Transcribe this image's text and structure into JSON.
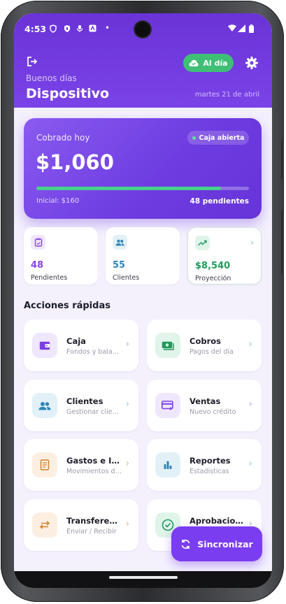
{
  "status": {
    "time": "4:53"
  },
  "header": {
    "greeting": "Buenos días",
    "title": "Dispositivo",
    "date": "martes 21 de abril",
    "sync_status": "Al día"
  },
  "summary": {
    "label": "Cobrado hoy",
    "amount": "$1,060",
    "badge": "Caja abierta",
    "progress_fraction": 0.87,
    "initial": "Inicial: $160",
    "pending": "48 pendientes"
  },
  "stats": [
    {
      "value": "48",
      "label": "Pendientes",
      "icon": "clipboard-icon",
      "color": "#8a44e8"
    },
    {
      "value": "55",
      "label": "Clientes",
      "icon": "people-icon",
      "color": "#2f86b8"
    },
    {
      "value": "$8,540",
      "label": "Proyección",
      "icon": "trend-up-icon",
      "color": "#1f9a5a"
    }
  ],
  "quick_actions_title": "Acciones rápidas",
  "actions": [
    {
      "name": "Caja",
      "sub": "Fondos y balances",
      "icon": "wallet-icon",
      "color": "#7a3fe0",
      "bg": "#efe7fd"
    },
    {
      "name": "Cobros",
      "sub": "Pagos del día",
      "icon": "cash-icon",
      "color": "#1f9a5a",
      "bg": "#e0f4ea"
    },
    {
      "name": "Clientes",
      "sub": "Gestionar clientes",
      "icon": "people-icon",
      "color": "#2f86b8",
      "bg": "#e2f1f8"
    },
    {
      "name": "Ventas",
      "sub": "Nuevo crédito",
      "icon": "card-add-icon",
      "color": "#7a3fe0",
      "bg": "#efe7fd"
    },
    {
      "name": "Gastos e Ingresos",
      "sub": "Movimientos diarios",
      "icon": "receipt-icon",
      "color": "#d4822d",
      "bg": "#fcefe2"
    },
    {
      "name": "Reportes",
      "sub": "Estadísticas",
      "icon": "bar-chart-icon",
      "color": "#2f86b8",
      "bg": "#e2f1f8"
    },
    {
      "name": "Transferencias",
      "sub": "Enviar / Recibir",
      "icon": "swap-icon",
      "color": "#d4822d",
      "bg": "#fcefe2"
    },
    {
      "name": "Aprobaciones",
      "sub": "",
      "icon": "check-circle-icon",
      "color": "#1f9a5a",
      "bg": "#e0f4ea"
    }
  ],
  "sync_button": "Sincronizar"
}
